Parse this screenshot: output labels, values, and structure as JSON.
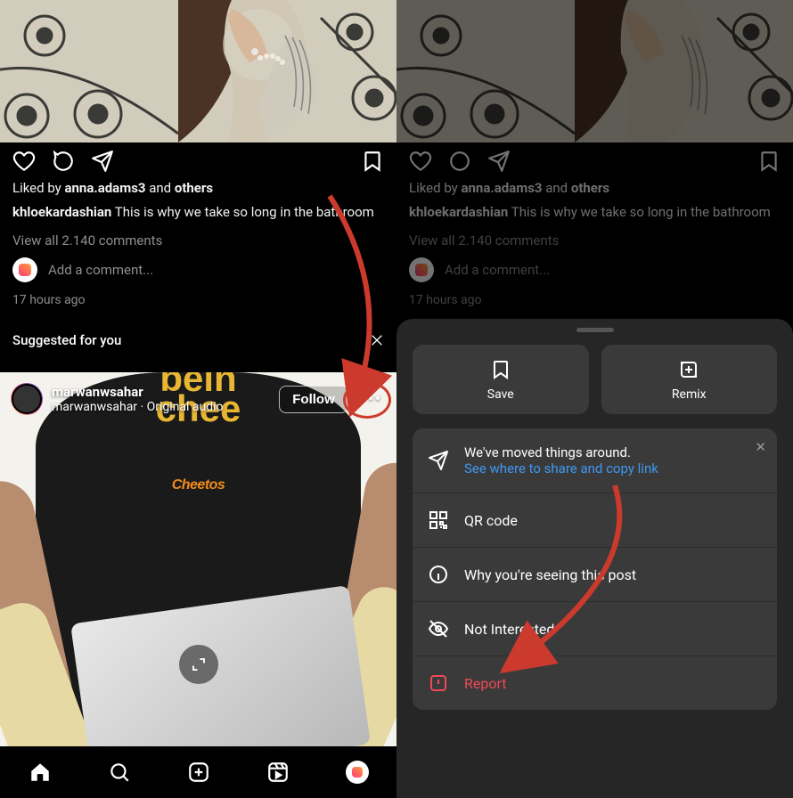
{
  "post": {
    "liked_prefix": "Liked by ",
    "liked_user": "anna.adams3",
    "liked_and": " and ",
    "liked_others": "others",
    "author": "khloekardashian",
    "caption_text": " This is why we take so long in the bathroom",
    "view_comments": "View all 2.140 comments",
    "comment_placeholder": "Add a comment...",
    "timestamp": "17 hours ago"
  },
  "suggested": {
    "label": "Suggested for you",
    "user": "marwanwsahar",
    "subtitle": "marwanwsahar · Original audio",
    "follow": "Follow",
    "logo_brand": "Cheetos"
  },
  "sheet": {
    "save": "Save",
    "remix": "Remix",
    "moved_title": "We've moved things around.",
    "moved_link": "See where to share and copy link",
    "qr": "QR code",
    "why": "Why you're seeing this post",
    "not_interested": "Not Interested",
    "report": "Report"
  }
}
